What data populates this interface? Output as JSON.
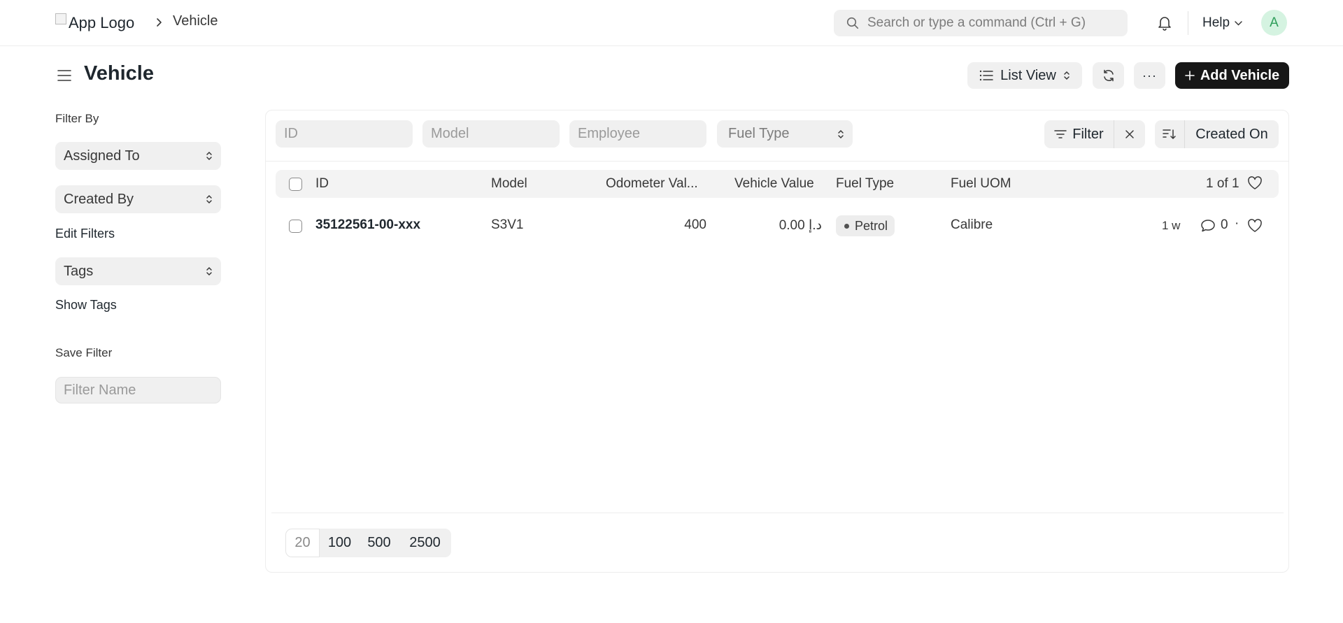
{
  "navbar": {
    "logo_alt": "App Logo",
    "breadcrumb": "Vehicle",
    "search_placeholder": "Search or type a command (Ctrl + G)",
    "help_label": "Help",
    "avatar_initial": "A"
  },
  "page": {
    "title": "Vehicle",
    "view_label": "List View",
    "more_label": "···",
    "add_label": "Add Vehicle"
  },
  "sidebar": {
    "filter_by": "Filter By",
    "assigned_to": "Assigned To",
    "created_by": "Created By",
    "edit_filters": "Edit Filters",
    "tags": "Tags",
    "show_tags": "Show Tags",
    "save_filter": "Save Filter",
    "filter_name_placeholder": "Filter Name"
  },
  "filters": {
    "id_placeholder": "ID",
    "model_placeholder": "Model",
    "employee_placeholder": "Employee",
    "fuel_type_placeholder": "Fuel Type",
    "filter_label": "Filter",
    "sort_label": "Created On"
  },
  "table": {
    "columns": {
      "id": "ID",
      "model": "Model",
      "odometer": "Odometer Val...",
      "vehicle_value": "Vehicle Value",
      "fuel_type": "Fuel Type",
      "fuel_uom": "Fuel UOM"
    },
    "count": "1 of 1",
    "rows": [
      {
        "id": "35122561-00-xxx",
        "model": "S3V1",
        "odometer": "400",
        "vehicle_value": "0.00 د.إ",
        "fuel_type": "Petrol",
        "fuel_uom": "Calibre",
        "modified": "1 w",
        "comments": "0",
        "sep": "·"
      }
    ]
  },
  "pager": {
    "sizes": [
      "20",
      "100",
      "500",
      "2500"
    ]
  },
  "colors": {
    "primary_button": "#171717",
    "avatar_bg": "#d5f3e1",
    "avatar_fg": "#2f9e5a",
    "control_bg": "#f0f0f0"
  }
}
